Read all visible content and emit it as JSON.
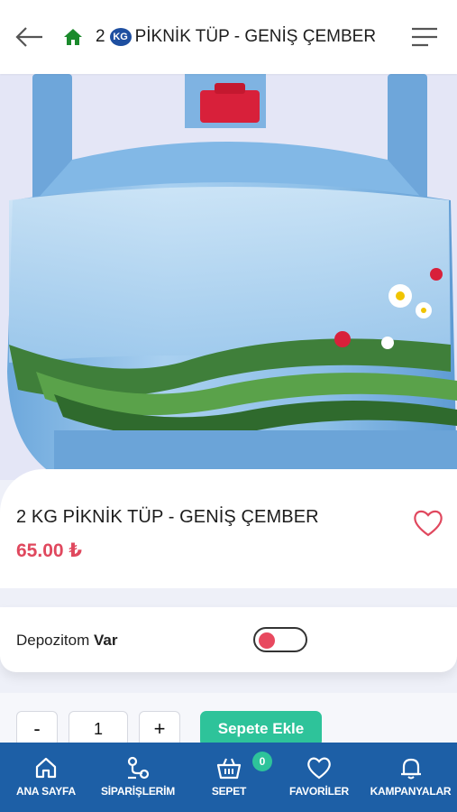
{
  "header": {
    "title_prefix": "2",
    "logo_text": "KG",
    "title_rest": "PİKNİK TÜP - GENİŞ ÇEMBER",
    "back_icon": "arrow-left-icon",
    "home_icon": "home-icon",
    "menu_icon": "menu-icon"
  },
  "product": {
    "name": "2 KG PİKNİK TÜP - GENİŞ ÇEMBER",
    "price": "65.00 ₺",
    "favorite_icon": "heart-outline-icon"
  },
  "deposit": {
    "label": "Depozitom",
    "value": "Var",
    "toggle_on": false
  },
  "quantity": {
    "minus": "-",
    "value": "1",
    "plus": "+",
    "add_to_cart": "Sepete Ekle"
  },
  "nav": {
    "items": [
      {
        "label": "ANA SAYFA",
        "icon": "home-icon"
      },
      {
        "label": "SİPARİŞLERİM",
        "icon": "orders-icon"
      },
      {
        "label": "SEPET",
        "icon": "basket-icon",
        "badge": "0"
      },
      {
        "label": "FAVORİLER",
        "icon": "heart-icon"
      },
      {
        "label": "KAMPANYALAR",
        "icon": "bell-icon"
      }
    ]
  },
  "colors": {
    "accent_red": "#e0485e",
    "accent_green": "#2ec39a",
    "nav_blue": "#1d5fa6",
    "home_green": "#1b8a2c"
  }
}
